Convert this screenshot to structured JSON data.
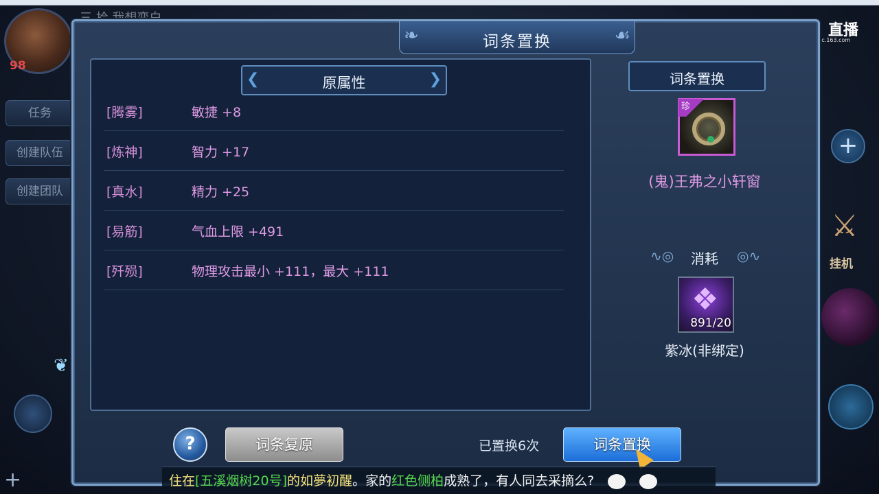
{
  "hud": {
    "player_name": "三 拾 我想变白",
    "level": "98",
    "left_buttons": [
      "任务",
      "创建队伍",
      "创建团队"
    ],
    "right_buttons": {
      "auto_label": "挂机"
    },
    "stream_logo": {
      "text": "直播",
      "url": "cc.163.com"
    }
  },
  "dialog": {
    "title": "词条置换",
    "original_attrs_header": "原属性",
    "attributes": [
      {
        "tag": "[腾雾]",
        "value": "敏捷 +8"
      },
      {
        "tag": "[炼神]",
        "value": "智力 +17"
      },
      {
        "tag": "[真水]",
        "value": "精力 +25"
      },
      {
        "tag": "[易筋]",
        "value": "气血上限 +491"
      },
      {
        "tag": "[歼殒]",
        "value": "物理攻击最小 +111，最大 +111"
      }
    ],
    "side_header": "词条置换",
    "item": {
      "rarity": "珍",
      "name": "(鬼)王弗之小轩窗"
    },
    "cost": {
      "label": "消耗",
      "count": "891/20",
      "name": "紫冰(非绑定)"
    },
    "help_label": "?",
    "restore_button": "词条复原",
    "replaced_count_text": "已置换6次",
    "replace_button": "词条置换"
  },
  "ticker": {
    "prefix": "住在",
    "place": "[五溪烟树20号]",
    "mid1": "的",
    "person": "如夢初醒",
    "mid2": "。家的",
    "plant": "红色侧柏",
    "suffix": "成熟了，有人同去采摘么?"
  },
  "colors": {
    "attr_text": "#e09ae6",
    "dialog_bg": "#1c2c44",
    "replace_button": "#1c6ed8",
    "restore_button": "#8d8d8d"
  }
}
